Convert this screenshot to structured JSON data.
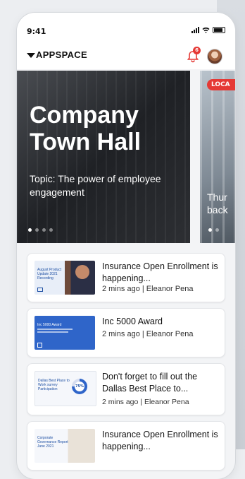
{
  "status_bar": {
    "time": "9:41"
  },
  "app_bar": {
    "logo_text": "APPSPACE",
    "notification_count": "6"
  },
  "carousel": {
    "slides": [
      {
        "title": "Company Town Hall",
        "topic": "Topic: The power of employee engagement"
      },
      {
        "badge": "LOCA",
        "text_line1": "Thur",
        "text_line2": "back"
      }
    ],
    "active_index": 0,
    "dot_count": 4
  },
  "feed": {
    "items": [
      {
        "title": "Insurance Open Enrollment is happening...",
        "time": "2 mins ago",
        "author": "Eleanor Pena",
        "thumb_text": "August Product Update 2021 Recording"
      },
      {
        "title": "Inc 5000 Award",
        "time": "2 mins ago",
        "author": "Eleanor Pena",
        "thumb_text": "Inc 5000 Award"
      },
      {
        "title": "Don't forget to fill out the Dallas Best Place to...",
        "time": "2 mins ago",
        "author": "Eleanor Pena",
        "thumb_text": "Dallas Best Place to Work survey Participation",
        "thumb_percent": "75%"
      },
      {
        "title": "Insurance Open Enrollment is happening...",
        "time": "",
        "author": "",
        "thumb_text": "Corporate Governance Report June 2021"
      }
    ]
  },
  "colors": {
    "accent_red": "#e53935",
    "hero_dark": "#1f2125",
    "inc_blue": "#2f65c9"
  }
}
